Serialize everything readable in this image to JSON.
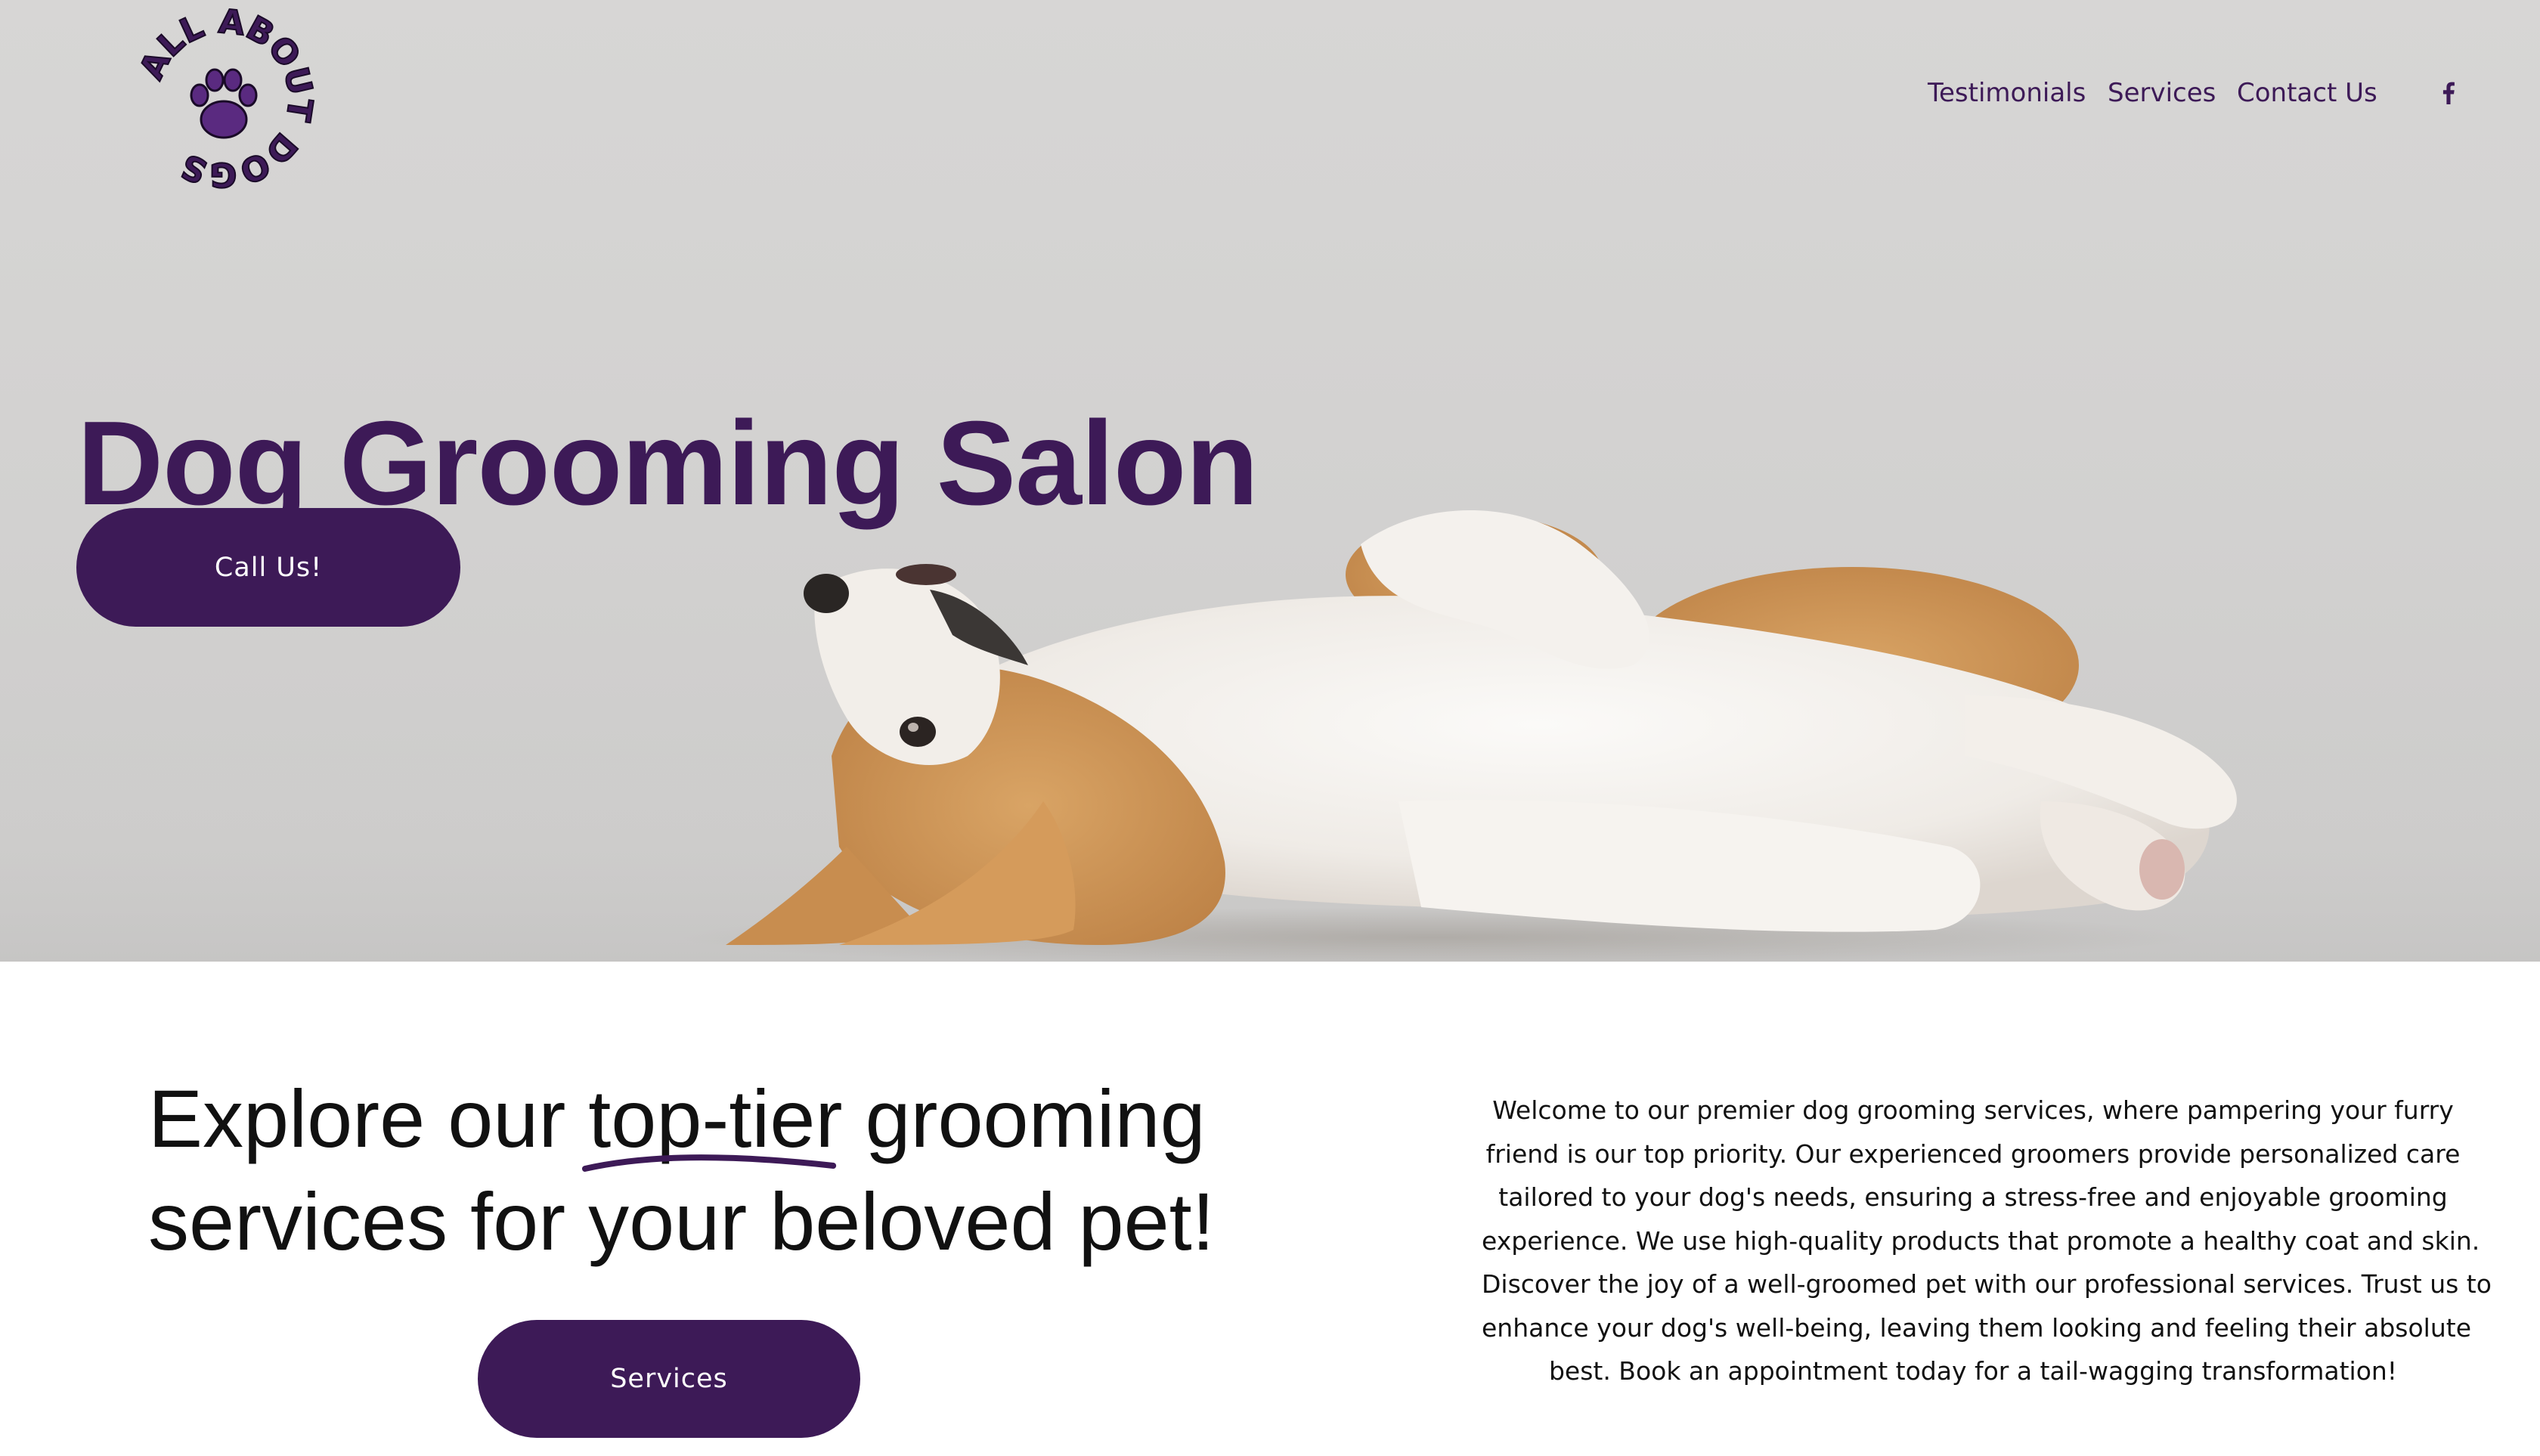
{
  "brand": {
    "logo_text": "ALL ABOUT DOGS",
    "accent_color": "#3d1a57"
  },
  "nav": {
    "items": [
      {
        "label": "Testimonials"
      },
      {
        "label": "Services"
      },
      {
        "label": "Contact Us"
      }
    ],
    "social_icon": "facebook-icon"
  },
  "hero": {
    "title": "Dog Grooming Salon",
    "cta_label": "Call Us!",
    "image": "corgi-puppy-lying-on-back-photo"
  },
  "intro": {
    "headline_part1": "Explore our ",
    "headline_highlight": "top-tier",
    "headline_part2": " grooming",
    "headline_line2": "services for your beloved pet!",
    "cta_label": "Services",
    "description_lines": [
      "Welcome to our premier dog grooming services, where pampering your furry",
      "friend is our top priority. Our experienced groomers provide personalized care",
      "tailored to your dog's needs, ensuring a stress-free and enjoyable grooming",
      "experience. We use high-quality products that promote a healthy coat and skin.",
      "Discover the joy of a well-groomed pet with our professional services. Trust us to",
      "enhance your dog's well-being, leaving them looking and feeling their absolute",
      "best. Book an appointment today for a tail-wagging transformation!"
    ]
  }
}
